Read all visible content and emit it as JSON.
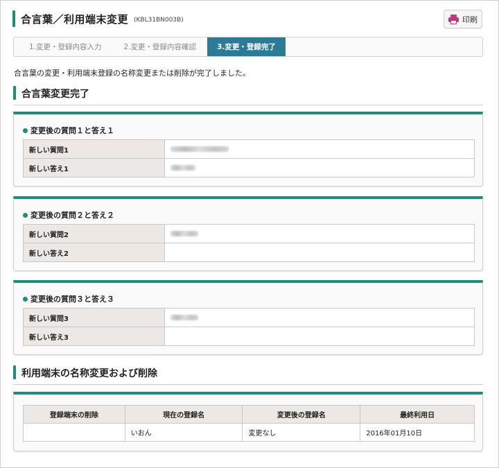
{
  "header": {
    "title": "合言葉／利用端末変更",
    "code": "(KBL31BN003B)",
    "print_label": "印刷"
  },
  "steps": [
    {
      "label": "1.変更・登録内容入力",
      "active": false
    },
    {
      "label": "2.変更・登録内容確認",
      "active": false
    },
    {
      "label": "3.変更・登録完了",
      "active": true
    }
  ],
  "message": "合言葉の変更・利用端末登録の名称変更または削除が完了しました。",
  "section_passphrase": {
    "title": "合言葉変更完了",
    "panels": [
      {
        "title": "変更後の質問１と答え１",
        "q_label": "新しい質問1",
        "a_label": "新しい答え1"
      },
      {
        "title": "変更後の質問２と答え２",
        "q_label": "新しい質問2",
        "a_label": "新しい答え2"
      },
      {
        "title": "変更後の質問３と答え３",
        "q_label": "新しい質問3",
        "a_label": "新しい答え3"
      }
    ]
  },
  "section_terminal": {
    "title": "利用端末の名称変更および削除",
    "columns": [
      "登録端末の削除",
      "現在の登録名",
      "変更後の登録名",
      "最終利用日"
    ],
    "row": {
      "delete": "",
      "current_name": "いおん",
      "new_name": "変更なし",
      "last_used": "2016年01月10日"
    }
  },
  "colors": {
    "accent": "#1e8c78",
    "step_active": "#2c7a96",
    "print_icon": "#c0367a"
  },
  "icons": {
    "print": "printer-icon",
    "panel_bullet": "dot-icon"
  }
}
